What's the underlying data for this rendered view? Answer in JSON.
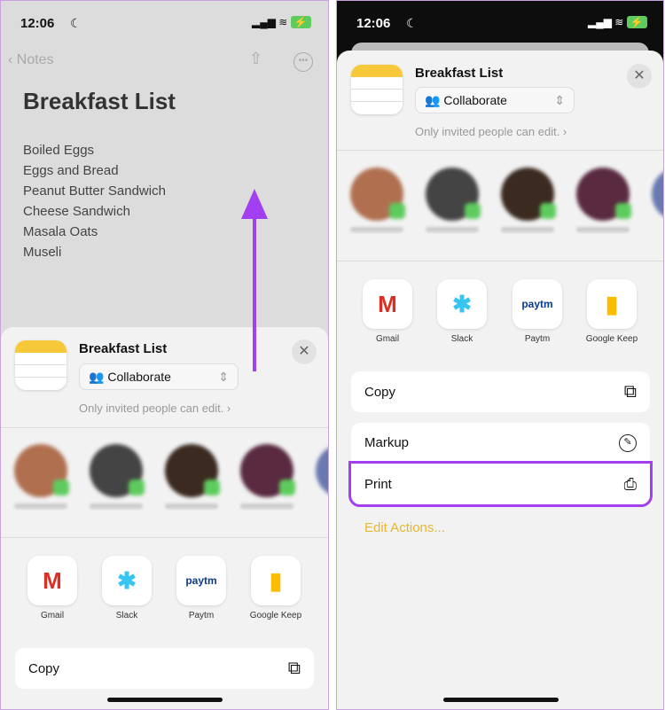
{
  "status": {
    "time": "12:06"
  },
  "left": {
    "nav": {
      "back_label": "Notes"
    },
    "note": {
      "title": "Breakfast List",
      "items": [
        "Boiled Eggs",
        "Eggs and Bread",
        "Peanut Butter Sandwich",
        "Cheese Sandwich",
        "Masala Oats",
        "Museli"
      ]
    },
    "sheet": {
      "title": "Breakfast List",
      "collaborate": "Collaborate",
      "subtitle": "Only invited people can edit. ›",
      "apps": [
        "Gmail",
        "Slack",
        "Paytm",
        "Google Keep"
      ],
      "actions": [
        "Copy"
      ]
    }
  },
  "right": {
    "sheet": {
      "title": "Breakfast List",
      "collaborate": "Collaborate",
      "subtitle": "Only invited people can edit. ›",
      "apps": [
        "Gmail",
        "Slack",
        "Paytm",
        "Google Keep"
      ],
      "actions": [
        "Copy",
        "Markup",
        "Print"
      ],
      "edit_actions": "Edit Actions..."
    }
  },
  "colors": {
    "accent_arrow": "#a23ff0",
    "highlight": "#a23ff0",
    "edit_actions": "#e6b830",
    "note_yellow": "#f7c83a"
  }
}
